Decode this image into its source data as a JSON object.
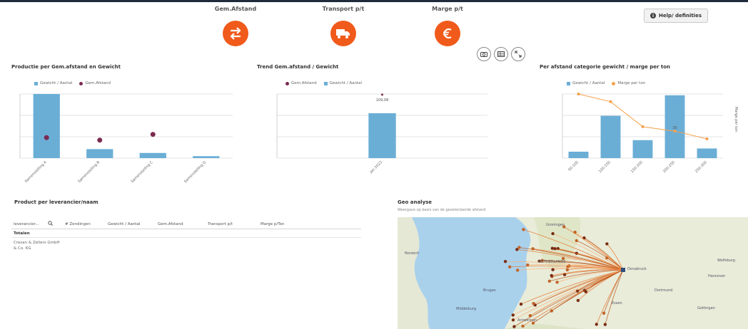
{
  "kpis": [
    {
      "label": "Gem.Afstand",
      "icon": "arrows-swap-icon"
    },
    {
      "label": "Transport p/t",
      "icon": "truck-icon"
    },
    {
      "label": "Marge p/t",
      "icon": "euro-icon"
    }
  ],
  "help_button": {
    "label": "Help/ definities",
    "icon": "info-icon"
  },
  "toolbar": {
    "icons": [
      "camera-icon",
      "table-icon",
      "expand-icon"
    ]
  },
  "colors": {
    "accent": "#f05a1a",
    "bar": "#6aaed6",
    "dot": "#7b2a50",
    "line": "#f5a04a"
  },
  "panels": {
    "production": {
      "title": "Productie per Gem.afstand en Gewicht",
      "legend": [
        "Gewicht / Aantal",
        "Gem.Afstand"
      ]
    },
    "trend": {
      "title": "Trend Gem.afstand / Gewicht",
      "legend": [
        "Gem.Afstand",
        "Gewicht / Aantal"
      ]
    },
    "category": {
      "title": "Per afstand categorie gewicht / marge per ton",
      "legend": [
        "Gewicht / Aantal",
        "Marge per ton"
      ],
      "side_label": "Marge per ton"
    },
    "products": {
      "title": "Product per leverancier/naam",
      "columns": [
        "leverancier...",
        "# Zendingen",
        "Gewicht / Aantal",
        "Gem.Afstand",
        "Transport p/t",
        "Marge p/Ton"
      ],
      "totals_label": "Totalen",
      "rows": [
        {
          "name": "Cresan & Zellers GmbH & Co. KG"
        }
      ]
    },
    "geo": {
      "title": "Geo analyse",
      "subtitle": "Weergave op basis van de geselecteerde afstand",
      "labels": [
        "Norwich",
        "NETHERLANDS",
        "Middelburg",
        "Antwerpen",
        "Groningen",
        "Osnabruck",
        "Wolfsburg",
        "Hannover",
        "Dortmund",
        "Gottingen",
        "Bruges",
        "Essen"
      ]
    }
  },
  "chart_data": [
    {
      "type": "bar",
      "title": "Productie per Gem.afstand en Gewicht",
      "categories": [
        "Samenstelling A",
        "Samenstelling B",
        "Samenstelling C",
        "Samenstelling D"
      ],
      "series": [
        {
          "name": "Gewicht / Aantal",
          "kind": "bar",
          "values": [
            100,
            14,
            8,
            3
          ]
        },
        {
          "name": "Gem.Afstand",
          "kind": "dot",
          "values": [
            32,
            28,
            37,
            null
          ]
        }
      ],
      "ylim": [
        0,
        100
      ],
      "grid": true,
      "legend": "top"
    },
    {
      "type": "bar",
      "title": "Trend Gem.afstand / Gewicht",
      "categories": [
        "jan 2023"
      ],
      "series": [
        {
          "name": "Gewicht / Aantal",
          "kind": "bar",
          "values": [
            77
          ]
        },
        {
          "name": "Gem.Afstand",
          "kind": "dot",
          "values": [
            109
          ]
        }
      ],
      "data_labels": [
        "109,08"
      ],
      "ylim": [
        0,
        110
      ],
      "grid": true,
      "legend": "top"
    },
    {
      "type": "bar",
      "title": "Per afstand categorie gewicht / marge per ton",
      "categories": [
        "50-100",
        "100-150",
        "150-200",
        "200-250",
        "250-300"
      ],
      "series": [
        {
          "name": "Gewicht / Aantal",
          "kind": "bar",
          "values": [
            10,
            66,
            28,
            98,
            15
          ]
        },
        {
          "name": "Marge per ton",
          "kind": "line",
          "values": [
            100,
            88,
            49,
            42,
            30
          ]
        }
      ],
      "data_labels": [
        "",
        "",
        "",
        "30",
        ""
      ],
      "ylim": [
        0,
        100
      ],
      "grid": true,
      "legend": "top"
    }
  ]
}
